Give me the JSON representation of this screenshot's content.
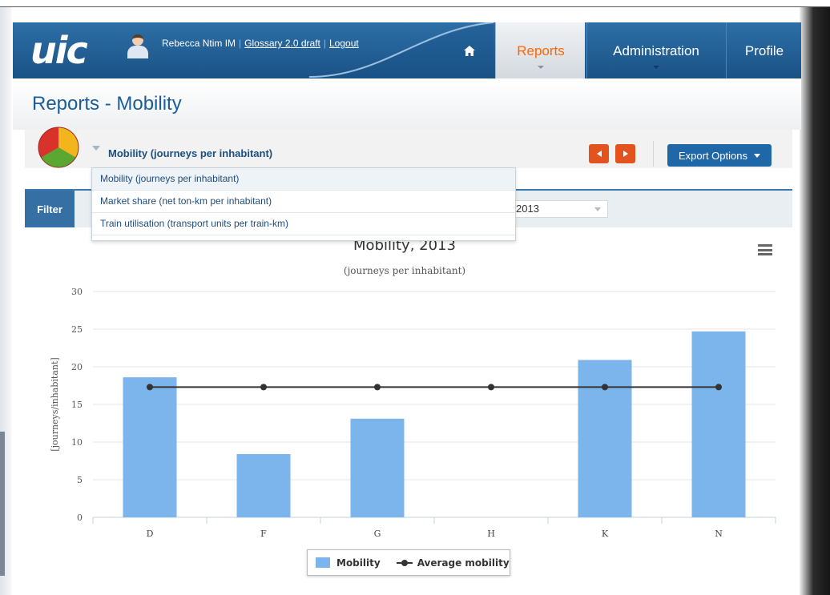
{
  "header": {
    "logo": "uic",
    "user_name": "Rebecca Ntim IM",
    "glossary_link": "Glossary 2.0 draft",
    "logout_link": "Logout",
    "nav": {
      "home_icon": "home-icon",
      "reports": "Reports",
      "administration": "Administration",
      "profile": "Profile"
    }
  },
  "page": {
    "title": "Reports - Mobility"
  },
  "toolbar": {
    "selected_indicator": "Mobility (journeys per inhabitant)",
    "prev_icon": "chevron-left-icon",
    "next_icon": "chevron-right-icon",
    "export_label": "Export Options"
  },
  "dropdown": {
    "options": [
      "Mobility (journeys per inhabitant)",
      "Market share (net ton-km per inhabitant)",
      "Train utilisation (transport units per train-km)"
    ]
  },
  "filter": {
    "tab_label": "Filter",
    "year_value": "2013"
  },
  "colors": {
    "bar": "#7cb5ec",
    "line": "#333333",
    "accent": "#e3531d",
    "brand": "#1f67a7"
  },
  "chart_data": {
    "type": "bar",
    "title": "Mobility, 2013",
    "subtitle": "(journeys per inhabitant)",
    "ylabel": "[journeys/inhabitant]",
    "xlabel": "",
    "categories": [
      "D",
      "F",
      "G",
      "H",
      "K",
      "N"
    ],
    "ylim": [
      0,
      30
    ],
    "yticks": [
      0,
      5,
      10,
      15,
      20,
      25,
      30
    ],
    "grid": true,
    "legend_position": "bottom",
    "series": [
      {
        "name": "Mobility",
        "type": "bar",
        "values": [
          18.6,
          8.4,
          13.1,
          null,
          20.9,
          24.7
        ]
      },
      {
        "name": "Average mobility",
        "type": "line",
        "values": [
          17.3,
          17.3,
          17.3,
          17.3,
          17.3,
          17.3
        ]
      }
    ]
  }
}
